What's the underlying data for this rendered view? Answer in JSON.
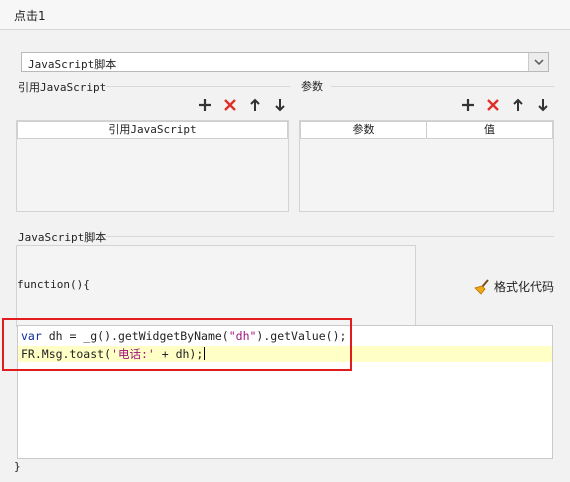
{
  "tab": {
    "label": "点击1"
  },
  "script_select": {
    "value": "JavaScript脚本"
  },
  "ref_section": {
    "title": "引用JavaScript",
    "column_header": "引用JavaScript"
  },
  "params_section": {
    "title": "参数",
    "columns": [
      "参数",
      "值"
    ]
  },
  "script_section": {
    "title": "JavaScript脚本",
    "function_open": "function(){",
    "function_close": "}"
  },
  "format_button": {
    "label": "格式化代码"
  },
  "code": {
    "line1": {
      "kw": "var",
      "a": " dh = _g().getWidgetByName(",
      "str": "\"dh\"",
      "b": ").getValue();"
    },
    "line2": {
      "a": "FR.Msg.toast(",
      "str": "'电话:'",
      "b": " + dh);"
    }
  },
  "icons": [
    "plus-icon",
    "delete-icon",
    "arrow-up-icon",
    "arrow-down-icon",
    "chevron-down-icon",
    "broom-icon"
  ],
  "colors": {
    "delete": "#e0302a",
    "highlight": "#ffffc6",
    "red_box": "#e21c1c",
    "keyword": "#0f2aa0",
    "string": "#a0127d"
  }
}
